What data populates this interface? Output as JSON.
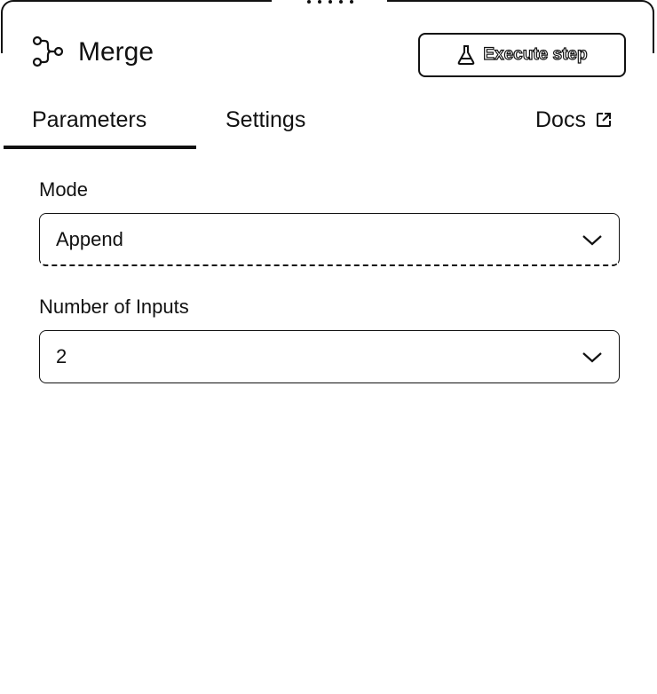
{
  "header": {
    "title": "Merge",
    "execute_label": "Execute step"
  },
  "tabs": [
    {
      "label": "Parameters",
      "active": true
    },
    {
      "label": "Settings",
      "active": false
    },
    {
      "label": "Docs",
      "active": false
    }
  ],
  "fields": {
    "mode": {
      "label": "Mode",
      "value": "Append"
    },
    "inputs": {
      "label": "Number of Inputs",
      "value": "2"
    }
  },
  "icons": {
    "node": "merge-node-icon",
    "execute": "flask-icon",
    "docs": "external-link-icon",
    "select": "chevron-down-icon"
  },
  "colors": {
    "foreground": "#111111",
    "background": "#ffffff"
  }
}
